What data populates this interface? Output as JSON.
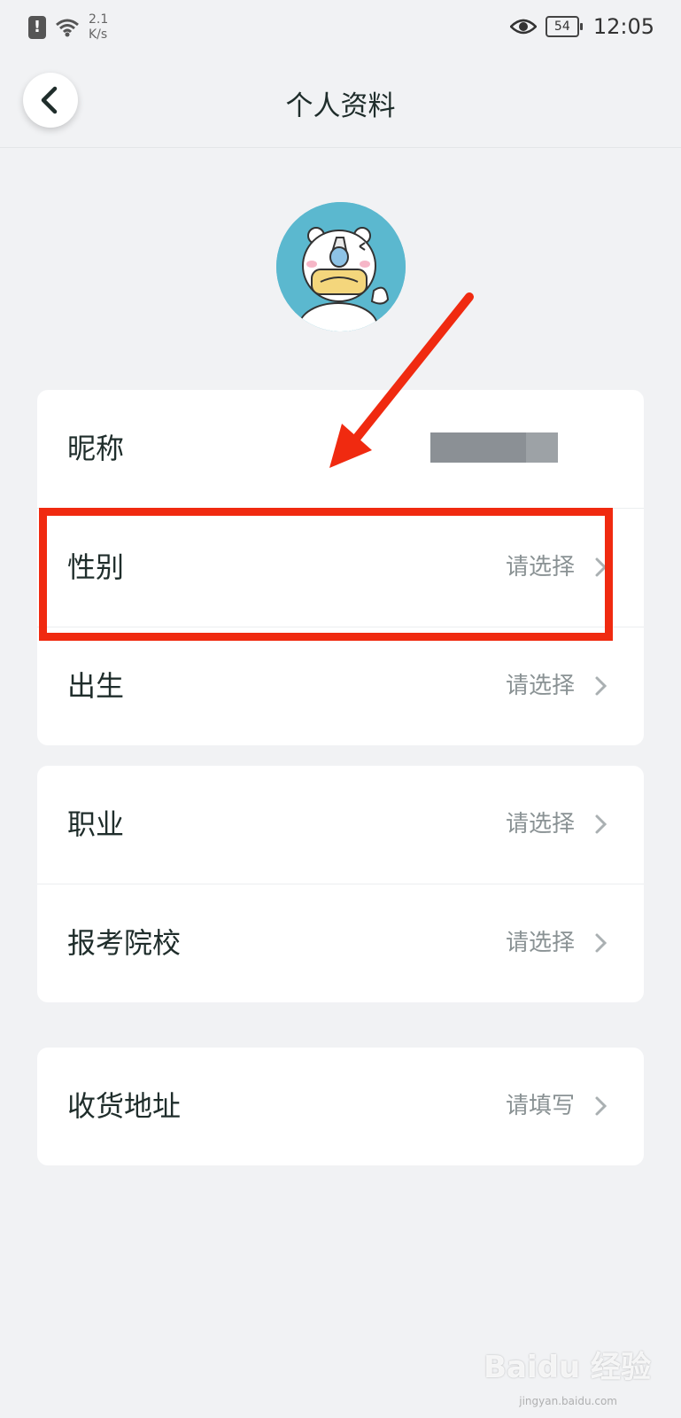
{
  "status_bar": {
    "network_speed": "2.1\nK/s",
    "battery_level": "54",
    "time": "12:05"
  },
  "header": {
    "title": "个人资料"
  },
  "profile_rows": {
    "nickname": {
      "label": "昵称"
    },
    "gender": {
      "label": "性别",
      "value": "请选择"
    },
    "birth": {
      "label": "出生",
      "value": "请选择"
    },
    "occupation": {
      "label": "职业",
      "value": "请选择"
    },
    "school": {
      "label": "报考院校",
      "value": "请选择"
    },
    "address": {
      "label": "收货地址",
      "value": "请填写"
    }
  },
  "annotation": {
    "highlight_color": "#f02a10"
  },
  "watermark": {
    "text": "Baidu 经验",
    "sub": "jingyan.baidu.com"
  },
  "colors": {
    "background": "#f1f2f4",
    "card": "#ffffff",
    "text": "#1f2d2b",
    "placeholder": "#8a9294",
    "avatar_bg": "#5bb8cf"
  }
}
